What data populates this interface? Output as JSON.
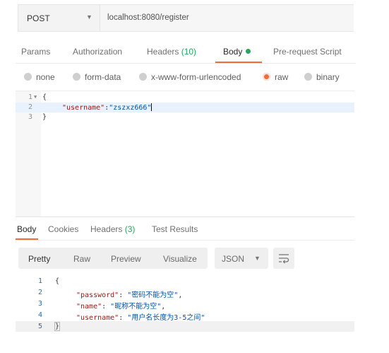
{
  "request": {
    "method": "POST",
    "url": "localhost:8080/register"
  },
  "request_tabs": [
    {
      "label": "Params"
    },
    {
      "label": "Authorization"
    },
    {
      "label": "Headers",
      "count": "(10)"
    },
    {
      "label": "Body"
    },
    {
      "label": "Pre-request Script"
    }
  ],
  "body_types": [
    "none",
    "form-data",
    "x-www-form-urlencoded",
    "raw",
    "binary"
  ],
  "selected_body_type": "raw",
  "request_body": {
    "line_numbers": [
      "1",
      "2",
      "3"
    ],
    "open_brace": "{",
    "key": "\"username\"",
    "colon": ":",
    "value": "\"zszxz666\"",
    "close_brace": "}"
  },
  "response_tabs": [
    {
      "label": "Body"
    },
    {
      "label": "Cookies"
    },
    {
      "label": "Headers",
      "count": "(3)"
    },
    {
      "label": "Test Results"
    }
  ],
  "view_modes": [
    "Pretty",
    "Raw",
    "Preview",
    "Visualize"
  ],
  "format": "JSON",
  "response_body": {
    "line_numbers": [
      "1",
      "2",
      "3",
      "4",
      "5"
    ],
    "open_brace": "{",
    "lines": [
      {
        "key": "\"password\"",
        "value": "\"密码不能为空\"",
        "trail": ","
      },
      {
        "key": "\"name\"",
        "value": "\"昵称不能为空\"",
        "trail": ","
      },
      {
        "key": "\"username\"",
        "value": "\"用户名长度为3-5之间\"",
        "trail": ""
      }
    ],
    "close_brace": "}"
  },
  "colors": {
    "accent": "#f26b3a",
    "count_green": "#26a65b"
  }
}
